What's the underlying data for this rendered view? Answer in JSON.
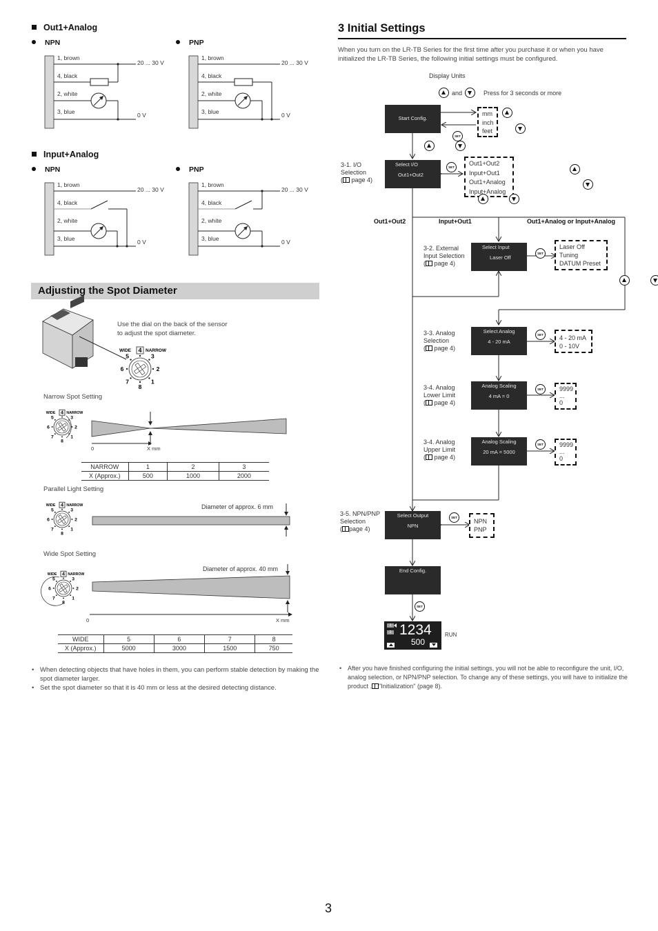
{
  "wiring": {
    "out1_analog": {
      "title": "Out1+Analog",
      "npn_label": "NPN",
      "pnp_label": "PNP"
    },
    "input_analog": {
      "title": "Input+Analog",
      "npn_label": "NPN",
      "pnp_label": "PNP"
    },
    "wires": [
      "1, brown",
      "4, black",
      "2, white",
      "3, blue"
    ],
    "supply_label": "20 ... 30 V",
    "ground_label": "0 V"
  },
  "spot": {
    "title": "Adjusting the Spot Diameter",
    "intro_line1": "Use the dial on the back of the sensor",
    "intro_line2": "to adjust the spot diameter.",
    "dial": {
      "wide": "WIDE",
      "narrow": "NARROW",
      "positions": [
        "1",
        "2",
        "3",
        "4",
        "5",
        "6",
        "7",
        "8"
      ],
      "selected": "4"
    },
    "narrow_setting": {
      "title": "Narrow Spot Setting",
      "axis_start": "0",
      "axis_label": "X mm",
      "table": {
        "header": [
          "NARROW",
          "1",
          "2",
          "3"
        ],
        "row": [
          "X (Approx.)",
          "500",
          "1000",
          "2000"
        ]
      }
    },
    "parallel_setting": {
      "title": "Parallel Light Setting",
      "diameter_note": "Diameter of approx. 6 mm"
    },
    "wide_setting": {
      "title": "Wide Spot Setting",
      "diameter_note": "Diameter of approx. 40 mm",
      "axis_start": "0",
      "axis_label": "X mm",
      "table": {
        "header": [
          "WIDE",
          "5",
          "6",
          "7",
          "8"
        ],
        "row": [
          "X (Approx.)",
          "5000",
          "3000",
          "1500",
          "750"
        ]
      }
    },
    "notes": [
      "When detecting objects that have holes in them, you can perform stable detection by making the spot diameter larger.",
      "Set the spot diameter so that it is 40 mm or less at the desired detecting distance."
    ]
  },
  "initial": {
    "title": "3   Initial Settings",
    "intro": "When you turn on the LR-TB Series for the first time after you purchase it or when you have initialized the LR-TB Series, the following initial settings must be configured.",
    "display_units_label": "Display Units",
    "and_label": "and",
    "press_label": "Press for 3 seconds or more",
    "set_label": "SET",
    "start": {
      "screen": "Start Config.",
      "options": [
        "mm",
        "inch",
        "feet"
      ]
    },
    "io": {
      "label": [
        "3-1. I/O",
        "Selection",
        "page 4)"
      ],
      "screen_title": "Select I/O",
      "screen_value": "Out1+Out2",
      "options": [
        "Out1+Out2",
        "Input+Out1",
        "Out1+Analog",
        "Input+Analog"
      ]
    },
    "branches": [
      "Out1+Out2",
      "Input+Out1",
      "Out1+Analog or Input+Analog"
    ],
    "ext_input": {
      "label": [
        "3-2. External",
        "Input Selection",
        "page 4)"
      ],
      "screen_title": "Select Input",
      "screen_value": "Laser Off",
      "options": [
        "Laser Off",
        "Tuning",
        "DATUM Preset"
      ]
    },
    "analog_sel": {
      "label": [
        "3-3. Analog",
        "Selection",
        "page 4)"
      ],
      "screen_title": "Select Analog",
      "screen_value": "4 - 20 mA",
      "options": [
        "4 - 20 mA",
        "0 - 10V"
      ]
    },
    "analog_lower": {
      "label": [
        "3-4. Analog",
        "Lower Limit",
        "page 4)"
      ],
      "screen_title": "Analog Scaling",
      "screen_value": "4 mA = 0",
      "options": [
        "9999",
        "...",
        "0"
      ]
    },
    "analog_upper": {
      "label": [
        "3-4. Analog",
        "Upper Limit",
        "page 4)"
      ],
      "screen_title": "Analog Scaling",
      "screen_value": "20 mA = 5000",
      "options": [
        "9999",
        "...",
        "0"
      ]
    },
    "npn_pnp": {
      "label": [
        "3-5. NPN/PNP",
        "Selection",
        "page 4)"
      ],
      "screen_title": "Select Output",
      "screen_value": "NPN",
      "options": [
        "NPN",
        "PNP"
      ]
    },
    "end": {
      "screen": "End Config."
    },
    "run": {
      "main_value": "1234",
      "sub_value": "500",
      "ch1": "1",
      "ch2": "2",
      "label": "RUN"
    },
    "note": "After you have finished configuring the initial settings, you will not be able to reconfigure the unit, I/O, analog selection, or NPN/PNP selection. To change any of these settings, you will have to initialize the product .",
    "note_ref": "\"Initialization\" (page 8)."
  },
  "page_number": "3"
}
